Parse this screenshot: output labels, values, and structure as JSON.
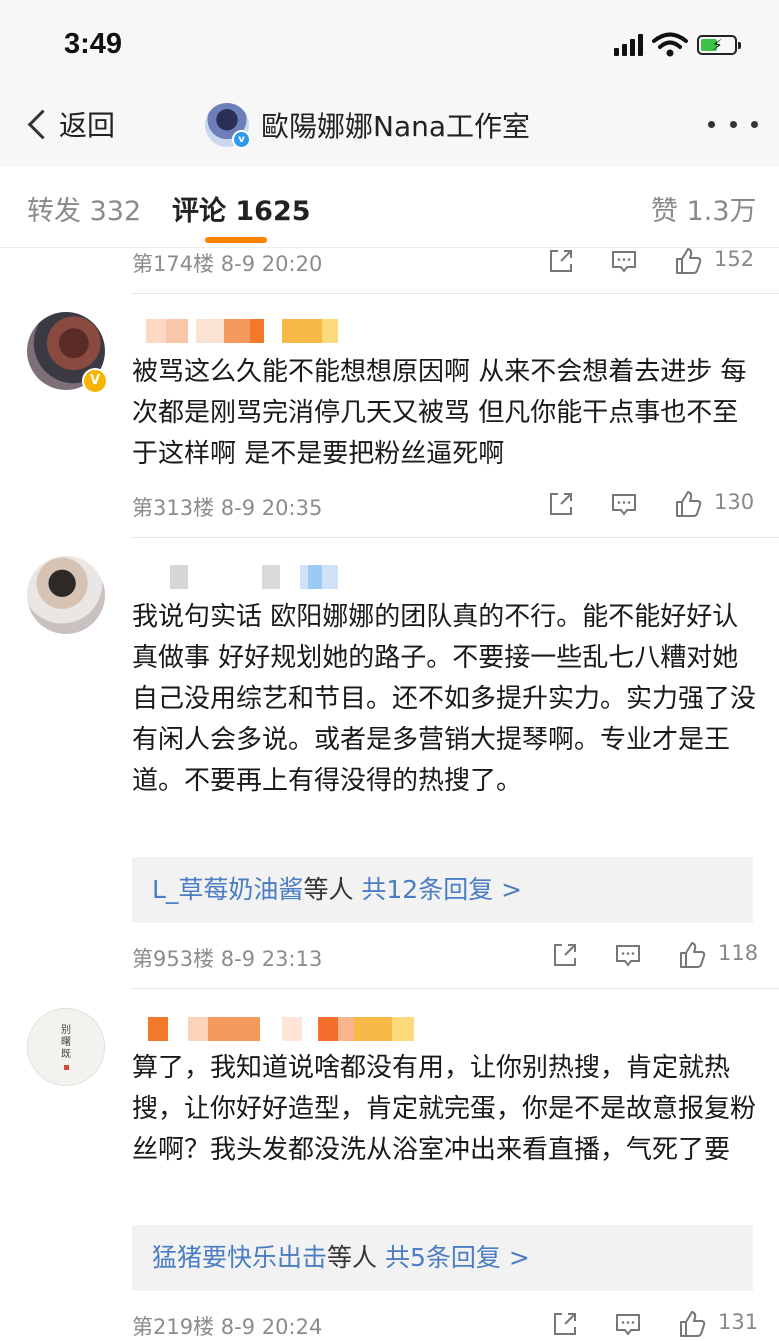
{
  "status_bar": {
    "time": "3:49"
  },
  "nav": {
    "back_label": "返回",
    "title": "歐陽娜娜Nana工作室"
  },
  "tabs": {
    "repost": "转发 332",
    "comments": "评论 1625",
    "likes": "赞 1.3万"
  },
  "comments": [
    {
      "floor": "第174楼",
      "date": "8-9",
      "time": "20:20",
      "likes": "152"
    },
    {
      "text": "被骂这么久能不能想想原因啊 从来不会想着去进步 每次都是刚骂完消停几天又被骂 但凡你能干点事也不至于这样啊 是不是要把粉丝逼死啊",
      "floor": "第313楼",
      "date": "8-9",
      "time": "20:35",
      "likes": "130"
    },
    {
      "text": "我说句实话 欧阳娜娜的团队真的不行。能不能好好认真做事 好好规划她的路子。不要接一些乱七八糟对她自己没用综艺和节目。还不如多提升实力。实力强了没有闲人会多说。或者是多营销大提琴啊。专业才是王道。不要再上有得没得的热搜了。",
      "reply_user": "L_草莓奶油酱",
      "reply_suffix": "等人",
      "reply_count": "共12条回复 >",
      "floor": "第953楼",
      "date": "8-9",
      "time": "23:13",
      "likes": "118"
    },
    {
      "text": "算了，我知道说啥都没有用，让你别热搜，肯定就热搜，让你好好造型，肯定就完蛋，你是不是故意报复粉丝啊？我头发都没洗从浴室冲出来看直播，气死了要",
      "reply_user": "猛猪要快乐出击",
      "reply_suffix": "等人",
      "reply_count": "共5条回复 >",
      "floor": "第219楼",
      "date": "8-9",
      "time": "20:24",
      "likes": "131",
      "avatar_text": "别曙既"
    }
  ],
  "colors": {
    "accent": "#ff8200",
    "link": "#4a7dc3",
    "verified_gold": "#f7b500",
    "verified_blue": "#2d9af0"
  },
  "icons": [
    "back-chevron-icon",
    "share-icon",
    "comment-icon",
    "like-icon",
    "more-icon",
    "signal-icon",
    "wifi-icon",
    "battery-icon"
  ]
}
